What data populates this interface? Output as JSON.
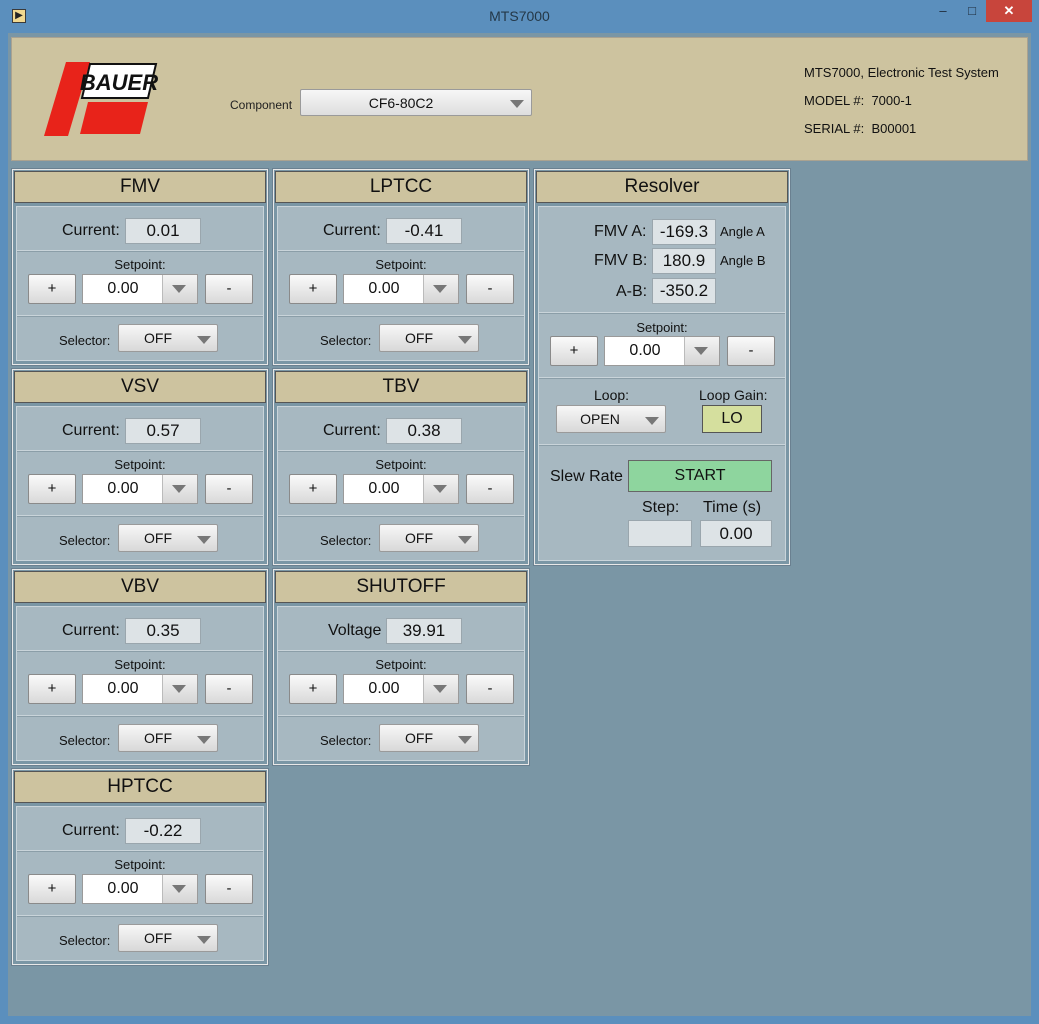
{
  "window": {
    "title": "MTS7000",
    "app_icon": "labview-icon",
    "minimize": "–",
    "maximize": "□",
    "close": "✕"
  },
  "header": {
    "logo_text": "BAUER",
    "component_label": "Component",
    "component_value": "CF6-80C2",
    "system_name": "MTS7000, Electronic Test System",
    "model_label": "MODEL #:",
    "model_value": "7000-1",
    "serial_label": "SERIAL #:",
    "serial_value": "B00001"
  },
  "panels": {
    "fmv": {
      "title": "FMV",
      "current_label": "Current:",
      "current": "0.01",
      "setpoint_label": "Setpoint:",
      "plus": "+",
      "setpoint": "0.00",
      "minus": "-",
      "selector_label": "Selector:",
      "selector": "OFF"
    },
    "lptcc": {
      "title": "LPTCC",
      "current_label": "Current:",
      "current": "-0.41",
      "setpoint_label": "Setpoint:",
      "plus": "+",
      "setpoint": "0.00",
      "minus": "-",
      "selector_label": "Selector:",
      "selector": "OFF"
    },
    "vsv": {
      "title": "VSV",
      "current_label": "Current:",
      "current": "0.57",
      "setpoint_label": "Setpoint:",
      "plus": "+",
      "setpoint": "0.00",
      "minus": "-",
      "selector_label": "Selector:",
      "selector": "OFF"
    },
    "tbv": {
      "title": "TBV",
      "current_label": "Current:",
      "current": "0.38",
      "setpoint_label": "Setpoint:",
      "plus": "+",
      "setpoint": "0.00",
      "minus": "-",
      "selector_label": "Selector:",
      "selector": "OFF"
    },
    "vbv": {
      "title": "VBV",
      "current_label": "Current:",
      "current": "0.35",
      "setpoint_label": "Setpoint:",
      "plus": "+",
      "setpoint": "0.00",
      "minus": "-",
      "selector_label": "Selector:",
      "selector": "OFF"
    },
    "shutoff": {
      "title": "SHUTOFF",
      "current_label": "Voltage",
      "current": "39.91",
      "setpoint_label": "Setpoint:",
      "plus": "+",
      "setpoint": "0.00",
      "minus": "-",
      "selector_label": "Selector:",
      "selector": "OFF"
    },
    "hptcc": {
      "title": "HPTCC",
      "current_label": "Current:",
      "current": "-0.22",
      "setpoint_label": "Setpoint:",
      "plus": "+",
      "setpoint": "0.00",
      "minus": "-",
      "selector_label": "Selector:",
      "selector": "OFF"
    }
  },
  "resolver": {
    "title": "Resolver",
    "fmva_label": "FMV A:",
    "fmva": "-169.3",
    "angle_a": "Angle A",
    "fmvb_label": "FMV B:",
    "fmvb": "180.9",
    "angle_b": "Angle B",
    "ab_label": "A-B:",
    "ab": "-350.2",
    "setpoint_label": "Setpoint:",
    "plus": "+",
    "setpoint": "0.00",
    "minus": "-",
    "loop_label": "Loop:",
    "loop": "OPEN",
    "loop_gain_label": "Loop Gain:",
    "loop_gain": "LO",
    "slew_label": "Slew Rate",
    "start": "START",
    "step_label": "Step:",
    "time_label": "Time (s)",
    "time": "0.00",
    "colors": {
      "loop_gain_bg": "#d5df9e",
      "start_bg": "#8ed59e"
    }
  }
}
